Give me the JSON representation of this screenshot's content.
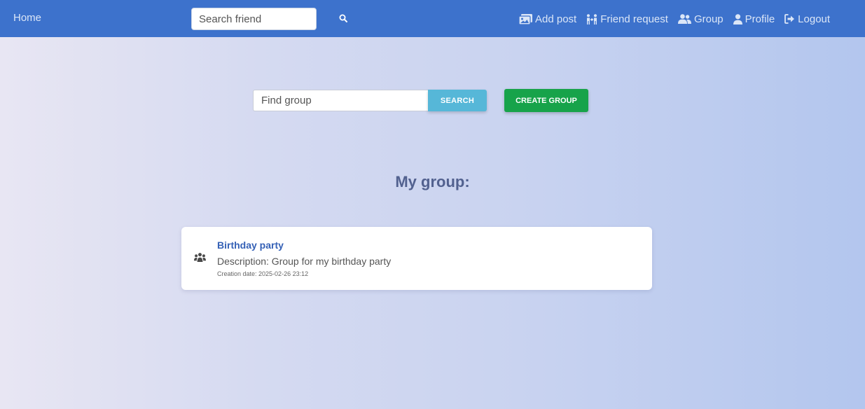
{
  "nav": {
    "home_label": "Home",
    "search_placeholder": "Search friend",
    "links": {
      "add_post": "Add post",
      "friend_request": "Friend request",
      "group": "Group",
      "profile": "Profile",
      "logout": "Logout"
    },
    "bg_color": "#3d72cc"
  },
  "group_search": {
    "placeholder": "Find group",
    "search_label": "SEARCH",
    "create_label": "CREATE GROUP"
  },
  "section": {
    "title": "My group:"
  },
  "groups": [
    {
      "name": "Birthday party",
      "description": "Description: Group for my birthday party",
      "creation_date": "Creation date: 2025-02-26 23:12",
      "icon": "users-icon"
    }
  ],
  "colors": {
    "accent": "#3d72cc",
    "search_btn": "#56b7d8",
    "create_btn": "#17a34a",
    "title": "#52618f"
  }
}
